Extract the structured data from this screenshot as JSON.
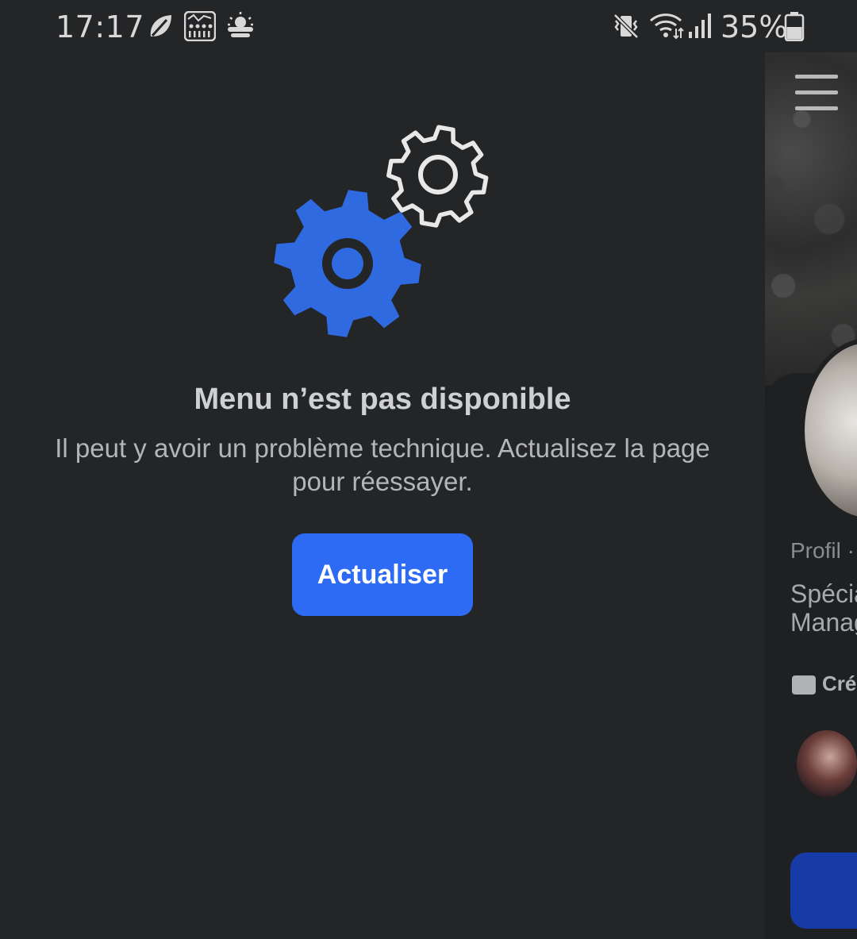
{
  "status_bar": {
    "time": "17:17",
    "battery_percent": "35%",
    "icons": [
      "leaf-icon",
      "app-grid-icon",
      "weather-sun-cloud-icon",
      "vibrate-mute-icon",
      "wifi-icon",
      "signal-icon",
      "battery-icon"
    ]
  },
  "drawer": {
    "title": "Menu n’est pas disponible",
    "message": "Il peut y avoir un problème technique. Actualisez la page pour réessayer.",
    "refresh_button": "Actualiser",
    "illustration": "gears-icon"
  },
  "background_profile": {
    "profile_label": "Profil ·",
    "line1": "Spécia",
    "line2": "Manag",
    "creator_label": "Cré"
  },
  "colors": {
    "background": "#242527",
    "accent": "#2d6bf5",
    "gear_blue": "#2f6ae0"
  }
}
